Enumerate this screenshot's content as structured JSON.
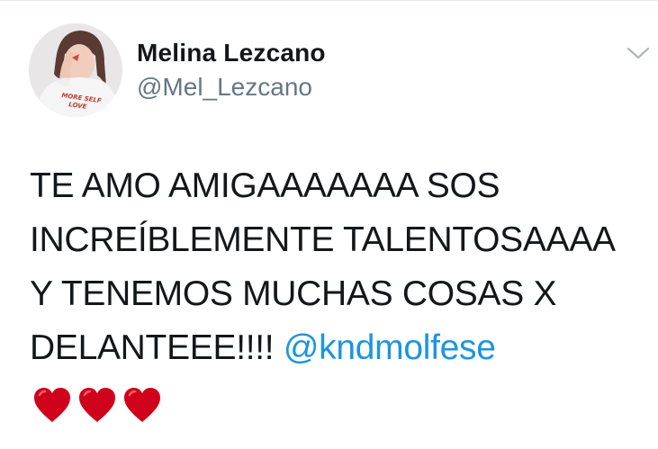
{
  "tweet": {
    "display_name": "Melina Lezcano",
    "handle": "@Mel_Lezcano",
    "avatar_text": "MORE SELF LOVE",
    "text_lines": [
      "TE AMO AMIGAAAAAAA SOS",
      "INCREÍBLEMENTE TALENTOSAAAA",
      "Y TENEMOS MUCHAS COSAS X",
      "DELANTEEE!!!! "
    ],
    "mention": "@kndmolfese",
    "emoji": [
      "red-heart",
      "red-heart",
      "red-heart"
    ],
    "colors": {
      "text": "#14171a",
      "secondary": "#657786",
      "link": "#1b95e0",
      "heart": "#d0021b"
    }
  }
}
